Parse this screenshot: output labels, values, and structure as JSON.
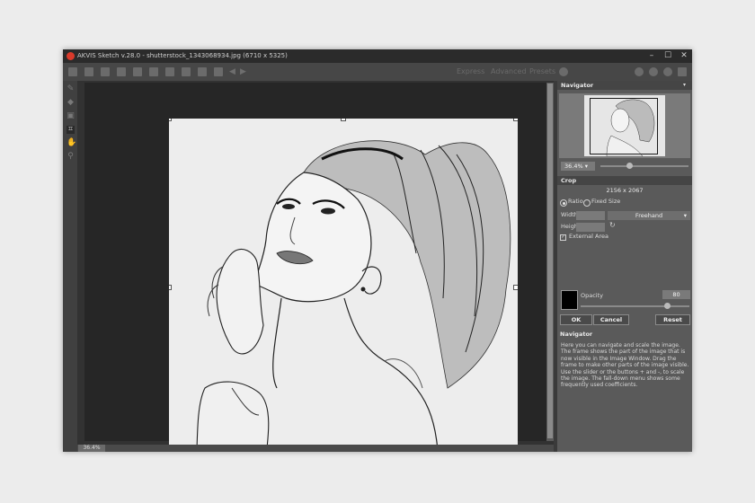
{
  "window": {
    "title": "AKVIS Sketch v.28.0 - shutterstock_1343068934.jpg (6710 x 5325)",
    "controls": {
      "minimize": "–",
      "maximize": "☐",
      "close": "✕"
    }
  },
  "toolbar": {
    "modes": [
      "Express",
      "Advanced",
      "Presets"
    ]
  },
  "canvas": {
    "zoom_label": "36.4%"
  },
  "navigator": {
    "header": "Navigator",
    "zoom_value": "36.4%"
  },
  "crop": {
    "header": "Crop",
    "dimensions": "2156 x 2067",
    "ratio_label": "Ratio",
    "fixed_size_label": "Fixed Size",
    "width_label": "Width",
    "height_label": "Height",
    "mode_value": "Freehand",
    "external_area_label": "External Area",
    "opacity_label": "Opacity",
    "opacity_value": "80",
    "opacity_fraction": 0.8,
    "swatch_color": "#000000"
  },
  "buttons": {
    "ok": "OK",
    "cancel": "Cancel",
    "reset": "Reset"
  },
  "help": {
    "header": "Navigator",
    "text": "Here you can navigate and scale the image. The frame shows the part of the image that is now visible in the Image Window. Drag the frame to make other parts of the image visible. Use the slider or the buttons + and -, to scale the image. The fall-down menu shows some frequently used coefficients."
  },
  "colors": {
    "accent_logo": "#d93a2b",
    "panel_bg": "#5a5a5a",
    "window_bg": "#3a3a3a"
  }
}
